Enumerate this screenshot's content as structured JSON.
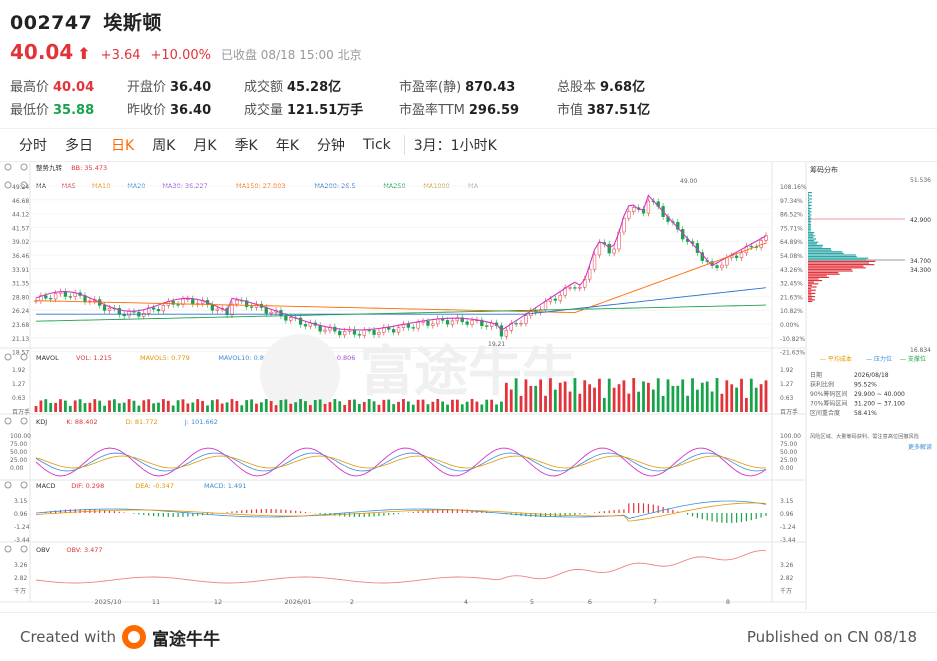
{
  "header": {
    "code": "002747",
    "name": "埃斯顿",
    "price": "40.04",
    "change": "+3.64",
    "change_pct": "+10.00%",
    "status": "已收盘 08/18 15:00 北京"
  },
  "stats": [
    {
      "label": "最高价",
      "value": "40.04",
      "tone": "red"
    },
    {
      "label": "开盘价",
      "value": "36.40",
      "tone": ""
    },
    {
      "label": "成交额",
      "value": "45.28亿",
      "tone": ""
    },
    {
      "label": "市盈率(静)",
      "value": "870.43",
      "tone": ""
    },
    {
      "label": "总股本",
      "value": "9.68亿",
      "tone": ""
    },
    {
      "label": "最低价",
      "value": "35.88",
      "tone": "green"
    },
    {
      "label": "昨收价",
      "value": "36.40",
      "tone": ""
    },
    {
      "label": "成交量",
      "value": "121.51万手",
      "tone": ""
    },
    {
      "label": "市盈率TTM",
      "value": "296.59",
      "tone": ""
    },
    {
      "label": "市值",
      "value": "387.51亿",
      "tone": ""
    }
  ],
  "tabs": [
    "分时",
    "多日",
    "日K",
    "周K",
    "月K",
    "季K",
    "年K",
    "分钟",
    "Tick",
    "3月：1小时K"
  ],
  "active_tab": "日K",
  "chart": {
    "legend_main": [
      "整势九转",
      "BB: 35.473",
      "MA",
      "MA5",
      "MA10",
      "MA20",
      "MA30: 36.227",
      "MA150: 27.803",
      "MA200: 26.5",
      "MA250",
      "MA1000",
      "MA"
    ],
    "legend_vol": [
      "MAVOL",
      "VOL: 1.215",
      "MAVOL5: 0.779",
      "MAVOL10: 0.815",
      "MAVOL20: 0.806"
    ],
    "legend_kdj": [
      "KDJ",
      "K: 88.402",
      "D: 81.772",
      "J: 101.662"
    ],
    "legend_macd": [
      "MACD",
      "DIF: 0.298",
      "DEA: -0.347",
      "MACD: 1.491"
    ],
    "legend_obv": [
      "OBV",
      "OBV: 3.477"
    ],
    "price_ticks": [
      "49.24",
      "46.68",
      "44.12",
      "41.57",
      "39.02",
      "36.46",
      "33.91",
      "31.35",
      "28.80",
      "26.24",
      "23.68",
      "21.13",
      "18.57"
    ],
    "pct_ticks": [
      "108.16%",
      "97.34%",
      "86.52%",
      "75.71%",
      "64.89%",
      "54.08%",
      "43.26%",
      "32.45%",
      "21.63%",
      "10.82%",
      "0.00%",
      "-10.82%",
      "-21.63%"
    ],
    "vol_ticks": [
      "1.92",
      "1.27",
      "0.63",
      "百万手"
    ],
    "vol_ticks_r": [
      "1.92",
      "1.27",
      "0.63",
      "百万手"
    ],
    "kdj_ticks": [
      "100.00",
      "75.00",
      "50.00",
      "25.00",
      "0.00"
    ],
    "macd_ticks": [
      "3.15",
      "0.96",
      "-1.24",
      "-3.44"
    ],
    "obv_ticks": [
      "3.26",
      "2.82",
      "千万"
    ],
    "x_labels": [
      "2025/10",
      "11",
      "12",
      "2026/01",
      "2",
      "4",
      "5",
      "6",
      "7",
      "8"
    ],
    "peak_label": "49.00",
    "low_label": "19.21",
    "watermark": "富途牛牛"
  },
  "chip": {
    "title": "筹码分布",
    "top_price": "51.536",
    "p1": "42.900",
    "p2": "34.700",
    "p3": "34.300",
    "bottom_price": "16.834",
    "legend": [
      "平均成本",
      "压力位",
      "支撑位"
    ],
    "rows": [
      {
        "k": "日期",
        "v": "2026/08/18"
      },
      {
        "k": "获利比例",
        "v": "95.52%"
      },
      {
        "k": "90%筹码区间",
        "v": "29.900 ~ 40.000"
      },
      {
        "k": "70%筹码区间",
        "v": "31.200 ~ 37.100"
      },
      {
        "k": "区间重合度",
        "v": "58.41%"
      }
    ],
    "note": "风险区域、大量筹码获利、需注意高位回撤风险",
    "more": "更多解读"
  },
  "footer": {
    "created": "Created with",
    "brand": "富途牛牛",
    "published": "Published on CN 08/18"
  }
}
